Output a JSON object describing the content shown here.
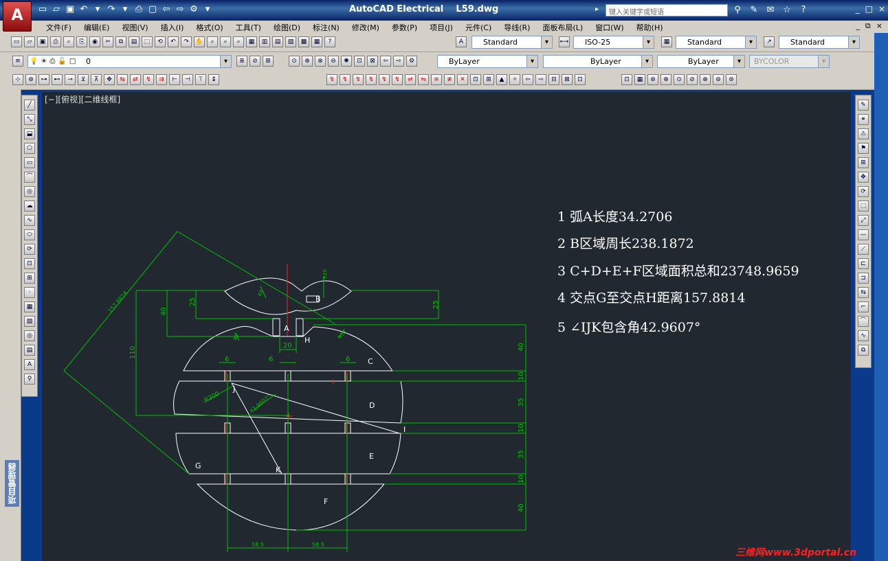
{
  "app": {
    "logo_letter": "A",
    "title": "AutoCAD Electrical    L59.dwg",
    "search_placeholder": "键入关键字或短语",
    "help_icon": "?",
    "window_controls": [
      "_",
      "□",
      "×"
    ],
    "doc_controls": [
      "_",
      "⧉",
      "×"
    ]
  },
  "menu": {
    "items": [
      "文件(F)",
      "编辑(E)",
      "视图(V)",
      "插入(I)",
      "格式(O)",
      "工具(T)",
      "绘图(D)",
      "标注(N)",
      "修改(M)",
      "参数(P)",
      "项目(J)",
      "元件(C)",
      "导线(R)",
      "面板布局(L)",
      "窗口(W)",
      "帮助(H)"
    ]
  },
  "styles": {
    "text_style": "Standard",
    "dim_style": "ISO-25",
    "table_style": "Standard",
    "multileader_style": "Standard"
  },
  "layers": {
    "current_layer": "0",
    "color": "ByLayer",
    "linetype": "ByLayer",
    "lineweight": "ByLayer",
    "plotstyle": "BYCOLOR"
  },
  "left_panel": {
    "title": "项目管理器"
  },
  "viewport": {
    "label": "[−][俯视][二维线框]"
  },
  "annotations": [
    "1  弧A长度34.2706",
    "2  B区域周长238.1872",
    "3  C+D+E+F区域面积总和23748.9659",
    "4  交点G至交点H距离157.8814",
    "5  ∠IJK包含角42.9607°"
  ],
  "drawing": {
    "region_labels": [
      "A",
      "B",
      "C",
      "D",
      "E",
      "F",
      "G",
      "H",
      "I",
      "J",
      "K"
    ],
    "dims": {
      "d25_left": "25",
      "d40_left": "40",
      "d110": "110",
      "d25_right": "25",
      "d20": "20",
      "d6a": "6",
      "d6b": "6",
      "d6c": "6",
      "r40": "40",
      "r10a": "10",
      "r35a": "35",
      "r10b": "10",
      "r35b": "35",
      "r10c": "10",
      "r40b": "40",
      "rad200": "R200",
      "b1": "58.5",
      "b2": "58.5",
      "diag": "157.8814",
      "ang": "42.9607°",
      "r_small1": "R8",
      "r_small2": "R8",
      "r_small3": "R20",
      "r_small4": "R20"
    },
    "colors": {
      "geometry": "#ffffff",
      "dimension": "#00c000",
      "center": "#ff2020",
      "background": "#212830"
    }
  },
  "watermark": "三维网www.3dportal.cn"
}
